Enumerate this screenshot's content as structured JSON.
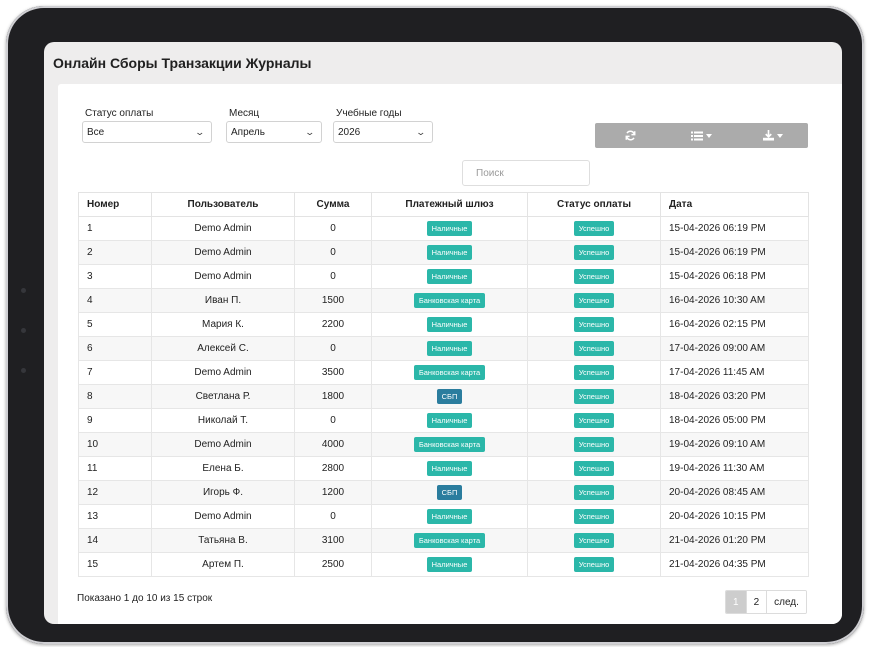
{
  "page": {
    "title": "Онлайн Сборы Транзакции Журналы"
  },
  "filters": [
    {
      "label": "Статус оплаты",
      "value": "Все"
    },
    {
      "label": "Месяц",
      "value": "Апрель"
    },
    {
      "label": "Учебные годы",
      "value": "2026"
    }
  ],
  "toolbar": {
    "refresh_icon": "refresh-icon",
    "columns_icon": "list-columns-icon",
    "export_icon": "download-icon"
  },
  "search": {
    "placeholder": "Поиск",
    "value": ""
  },
  "table": {
    "headers": [
      "Номер",
      "Пользователь",
      "Сумма",
      "Платежный шлюз",
      "Статус оплаты",
      "Дата"
    ],
    "rows": [
      {
        "num": "1",
        "user": "Demo Admin",
        "amount": "0",
        "gateway": "Наличные",
        "status": "Успешно",
        "date": "15-04-2026 06:19 PM"
      },
      {
        "num": "2",
        "user": "Demo Admin",
        "amount": "0",
        "gateway": "Наличные",
        "status": "Успешно",
        "date": "15-04-2026 06:19 PM"
      },
      {
        "num": "3",
        "user": "Demo Admin",
        "amount": "0",
        "gateway": "Наличные",
        "status": "Успешно",
        "date": "15-04-2026 06:18 PM"
      },
      {
        "num": "4",
        "user": "Иван П.",
        "amount": "1500",
        "gateway": "Банковская карта",
        "status": "Успешно",
        "date": "16-04-2026 10:30 AM"
      },
      {
        "num": "5",
        "user": "Мария К.",
        "amount": "2200",
        "gateway": "Наличные",
        "status": "Успешно",
        "date": "16-04-2026 02:15 PM"
      },
      {
        "num": "6",
        "user": "Алексей С.",
        "amount": "0",
        "gateway": "Наличные",
        "status": "Успешно",
        "date": "17-04-2026 09:00 AM"
      },
      {
        "num": "7",
        "user": "Demo Admin",
        "amount": "3500",
        "gateway": "Банковская карта",
        "status": "Успешно",
        "date": "17-04-2026 11:45 AM"
      },
      {
        "num": "8",
        "user": "Светлана Р.",
        "amount": "1800",
        "gateway": "СБП",
        "status": "Успешно",
        "date": "18-04-2026 03:20 PM"
      },
      {
        "num": "9",
        "user": "Николай Т.",
        "amount": "0",
        "gateway": "Наличные",
        "status": "Успешно",
        "date": "18-04-2026 05:00 PM"
      },
      {
        "num": "10",
        "user": "Demo Admin",
        "amount": "4000",
        "gateway": "Банковская карта",
        "status": "Успешно",
        "date": "19-04-2026 09:10 AM"
      },
      {
        "num": "11",
        "user": "Елена Б.",
        "amount": "2800",
        "gateway": "Наличные",
        "status": "Успешно",
        "date": "19-04-2026 11:30 AM"
      },
      {
        "num": "12",
        "user": "Игорь Ф.",
        "amount": "1200",
        "gateway": "СБП",
        "status": "Успешно",
        "date": "20-04-2026 08:45 AM"
      },
      {
        "num": "13",
        "user": "Demo Admin",
        "amount": "0",
        "gateway": "Наличные",
        "status": "Успешно",
        "date": "20-04-2026 10:15 PM"
      },
      {
        "num": "14",
        "user": "Татьяна В.",
        "amount": "3100",
        "gateway": "Банковская карта",
        "status": "Успешно",
        "date": "21-04-2026 01:20 PM"
      },
      {
        "num": "15",
        "user": "Артем П.",
        "amount": "2500",
        "gateway": "Наличные",
        "status": "Успешно",
        "date": "21-04-2026 04:35 PM"
      }
    ]
  },
  "footer": {
    "summary": "Показано 1 до 10 из 15 строк"
  },
  "pagination": {
    "pages": [
      "1",
      "2"
    ],
    "active": "1",
    "next": "след."
  },
  "colors": {
    "teal_badge": "#2bb7a9",
    "blue_badge": "#2b7d9e",
    "toolbar_bg": "#ababab"
  }
}
